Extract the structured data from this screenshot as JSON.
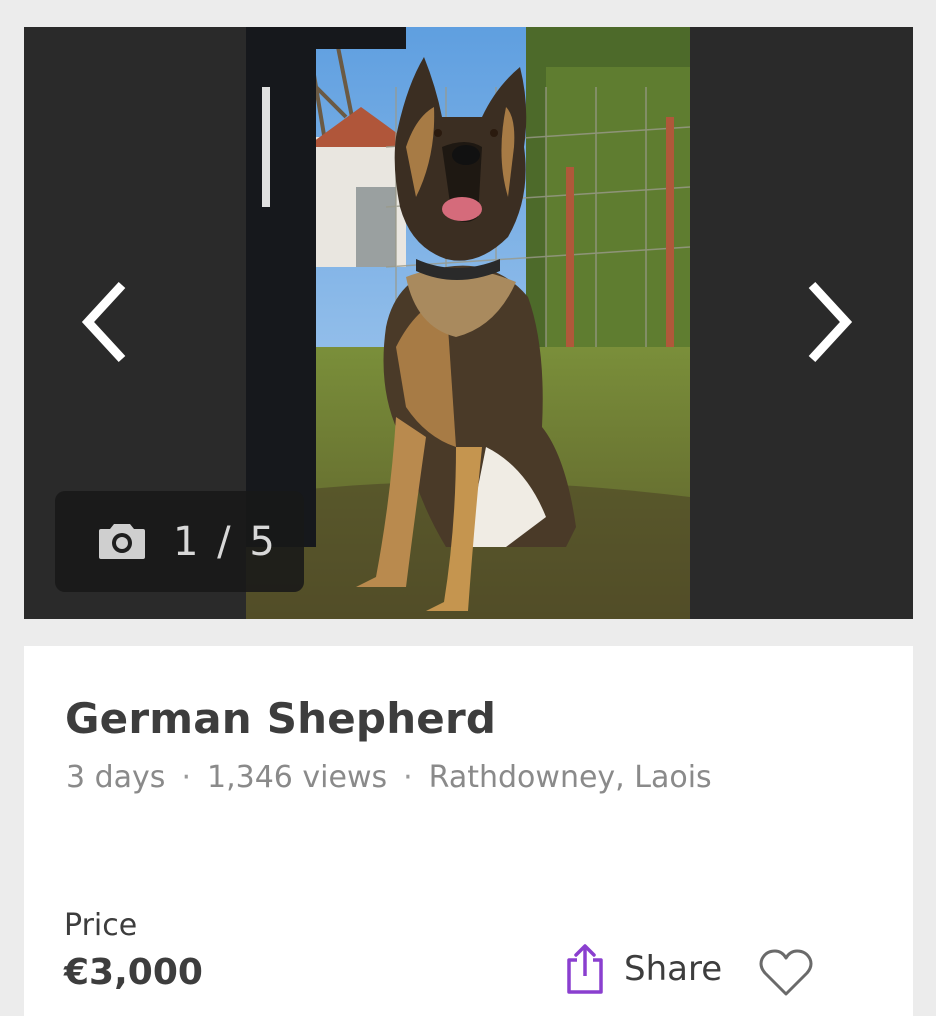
{
  "gallery": {
    "prev_icon": "chevron-left-icon",
    "next_icon": "chevron-right-icon",
    "camera_icon": "camera-icon",
    "counter": "1 / 5",
    "current_photo": 1,
    "total_photos": 5
  },
  "listing": {
    "title": "German Shepherd",
    "age": "3 days",
    "views": "1,346 views",
    "location": "Rathdowney, Laois",
    "separator": "·",
    "price_label": "Price",
    "price": "€3,000"
  },
  "actions": {
    "share_label": "Share",
    "share_icon": "share-icon",
    "favorite_icon": "heart-icon"
  },
  "colors": {
    "gallery_bg": "#2a2a2a",
    "accent": "#8a3fcf",
    "text": "#3d3d3d",
    "muted": "#8a8a8a"
  }
}
